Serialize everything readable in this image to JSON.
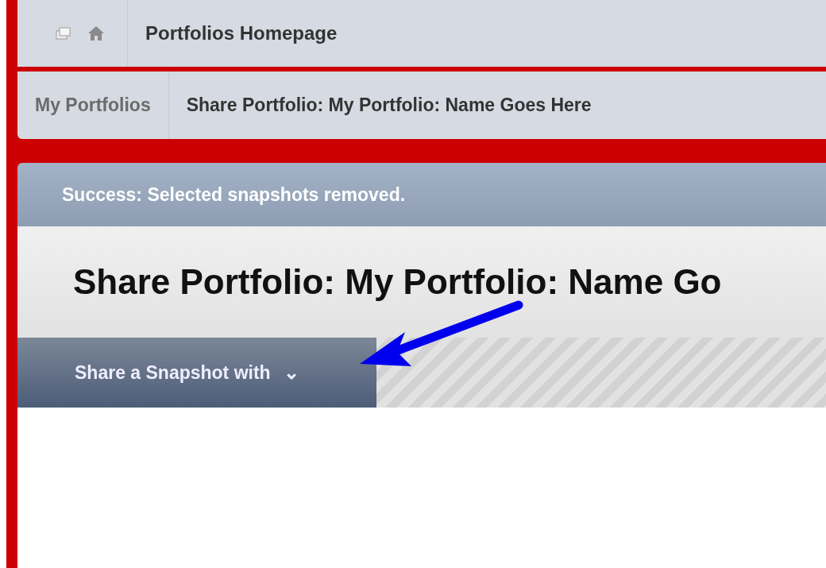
{
  "top_bar": {
    "title": "Portfolios Homepage"
  },
  "breadcrumbs": [
    {
      "label": "My Portfolios",
      "selected": false
    },
    {
      "label": "Share Portfolio: My Portfolio: Name Goes Here",
      "selected": true
    }
  ],
  "message": {
    "kind": "success",
    "text": "Success: Selected snapshots removed."
  },
  "page_title": "Share Portfolio: My Portfolio: Name Go",
  "action_bar": {
    "button": {
      "label": "Share a Snapshot with",
      "icon": "⌄"
    }
  },
  "annotation": {
    "kind": "arrow"
  }
}
